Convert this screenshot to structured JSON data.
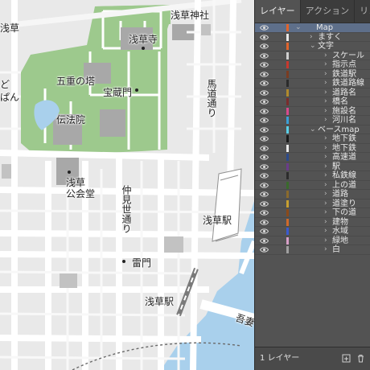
{
  "map": {
    "labels": {
      "asakusa_tl": "浅草",
      "asakusa_jinja": "浅草神社",
      "sensoji": "浅草寺",
      "goju_no_to": "五重の塔",
      "hozomon": "宝蔵門",
      "umamichi": "馬道通り",
      "denpoin": "伝法院",
      "left_cut1": "ど",
      "left_cut2": "ぱん",
      "kokaido": "浅草\n公会堂",
      "nakamise": "仲見世通り",
      "asakusa_station_e": "浅草駅",
      "kaminarimon": "雷門",
      "asakusa_station_s": "浅草駅",
      "azuma": "吾妻"
    }
  },
  "panel": {
    "tabs": [
      "レイヤー",
      "アクション",
      "リンク"
    ],
    "active_tab": 0,
    "layers": [
      {
        "label": "Map",
        "indent": 0,
        "twirl": "⌄",
        "color": "#e0642c",
        "selected": true
      },
      {
        "label": "ますく",
        "indent": 1,
        "twirl": "›",
        "color": "#e8e8e8"
      },
      {
        "label": "文字",
        "indent": 1,
        "twirl": "⌄",
        "color": "#e0642c"
      },
      {
        "label": "スケール",
        "indent": 2,
        "twirl": "›",
        "color": "#cfcfcf"
      },
      {
        "label": "指示点",
        "indent": 2,
        "twirl": "›",
        "color": "#c8382e"
      },
      {
        "label": "鉄道駅",
        "indent": 2,
        "twirl": "›",
        "color": "#7a3c22"
      },
      {
        "label": "鉄道路線",
        "indent": 2,
        "twirl": "›",
        "color": "#2b2b2b"
      },
      {
        "label": "道路名",
        "indent": 2,
        "twirl": "›",
        "color": "#b08a2c"
      },
      {
        "label": "橋名",
        "indent": 2,
        "twirl": "›",
        "color": "#7a2c2c"
      },
      {
        "label": "施設名",
        "indent": 2,
        "twirl": "›",
        "color": "#d84a8e"
      },
      {
        "label": "河川名",
        "indent": 2,
        "twirl": "›",
        "color": "#3aa0d8"
      },
      {
        "label": "ベースmap",
        "indent": 1,
        "twirl": "⌄",
        "color": "#5ad0e8"
      },
      {
        "label": "地下鉄",
        "indent": 2,
        "twirl": "›",
        "color": "#1a1a1a"
      },
      {
        "label": "地下鉄",
        "indent": 2,
        "twirl": "›",
        "color": "#e8e8e8"
      },
      {
        "label": "高速道",
        "indent": 2,
        "twirl": "›",
        "color": "#2c4a8a"
      },
      {
        "label": "駅",
        "indent": 2,
        "twirl": "›",
        "color": "#6a3c8a"
      },
      {
        "label": "私鉄線",
        "indent": 2,
        "twirl": "›",
        "color": "#2c2c2c"
      },
      {
        "label": "上の道",
        "indent": 2,
        "twirl": "›",
        "color": "#3a6a2c"
      },
      {
        "label": "道路",
        "indent": 2,
        "twirl": "›",
        "color": "#8a6a2c"
      },
      {
        "label": "道塗り",
        "indent": 2,
        "twirl": "›",
        "color": "#c8a030"
      },
      {
        "label": "下の道",
        "indent": 2,
        "twirl": "›",
        "color": "#8a4a1a"
      },
      {
        "label": "建物",
        "indent": 2,
        "twirl": "›",
        "color": "#d06a2a"
      },
      {
        "label": "水域",
        "indent": 2,
        "twirl": "›",
        "color": "#3a5ad0"
      },
      {
        "label": "緑地",
        "indent": 2,
        "twirl": "›",
        "color": "#d8a0c8"
      },
      {
        "label": "白",
        "indent": 2,
        "twirl": "›",
        "color": "#a0a0a0"
      }
    ],
    "footer": {
      "layer_count": "1 レイヤー"
    }
  }
}
